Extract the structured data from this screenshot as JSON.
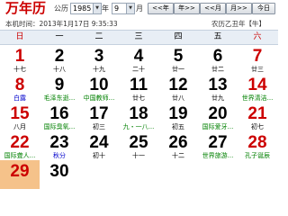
{
  "header": {
    "title": "万年历",
    "calendar_type_label": "公历",
    "year": "1985",
    "year_unit": "年",
    "month": "9",
    "month_unit": "月",
    "nav": {
      "prev_year": "<<年",
      "next_year": "年>>",
      "prev_month": "<<月",
      "next_month": "月>>",
      "today": "今日"
    }
  },
  "subheader": {
    "local_time_label": "本机时间：",
    "local_time": "2013年1月17日 9:35:33",
    "lunar_year": "农历乙丑年【牛】"
  },
  "weekdays": [
    "日",
    "一",
    "二",
    "三",
    "四",
    "五",
    "六"
  ],
  "colors": {
    "weekend": "#cc0000",
    "festival": "#008000",
    "term": "#0000cc",
    "today_bg": "#f5c28a"
  },
  "weeks": [
    [
      {
        "day": "1",
        "sub": "十七",
        "style": ""
      },
      {
        "day": "2",
        "sub": "十八",
        "style": ""
      },
      {
        "day": "3",
        "sub": "十九",
        "style": ""
      },
      {
        "day": "4",
        "sub": "二十",
        "style": ""
      },
      {
        "day": "5",
        "sub": "廿一",
        "style": ""
      },
      {
        "day": "6",
        "sub": "廿二",
        "style": ""
      },
      {
        "day": "7",
        "sub": "廿三",
        "style": ""
      }
    ],
    [
      {
        "day": "8",
        "sub": "白露",
        "style": "blue"
      },
      {
        "day": "9",
        "sub": "毛泽东逝...",
        "style": "green"
      },
      {
        "day": "10",
        "sub": "中国教师...",
        "style": "green"
      },
      {
        "day": "11",
        "sub": "廿七",
        "style": ""
      },
      {
        "day": "12",
        "sub": "廿八",
        "style": ""
      },
      {
        "day": "13",
        "sub": "廿九",
        "style": ""
      },
      {
        "day": "14",
        "sub": "世界清洁...",
        "style": "green"
      }
    ],
    [
      {
        "day": "15",
        "sub": "八月",
        "style": ""
      },
      {
        "day": "16",
        "sub": "国际臭氧...",
        "style": "green"
      },
      {
        "day": "17",
        "sub": "初三",
        "style": ""
      },
      {
        "day": "18",
        "sub": "九・一八...",
        "style": "green"
      },
      {
        "day": "19",
        "sub": "初五",
        "style": ""
      },
      {
        "day": "20",
        "sub": "国际爱牙...",
        "style": "green"
      },
      {
        "day": "21",
        "sub": "初七",
        "style": ""
      }
    ],
    [
      {
        "day": "22",
        "sub": "国际聋人...",
        "style": "green"
      },
      {
        "day": "23",
        "sub": "秋分",
        "style": "blue"
      },
      {
        "day": "24",
        "sub": "初十",
        "style": ""
      },
      {
        "day": "25",
        "sub": "十一",
        "style": ""
      },
      {
        "day": "26",
        "sub": "十二",
        "style": ""
      },
      {
        "day": "27",
        "sub": "世界旅游...",
        "style": "green"
      },
      {
        "day": "28",
        "sub": "孔子诞辰",
        "style": "green"
      }
    ],
    [
      {
        "day": "29",
        "sub": "",
        "style": "today"
      },
      {
        "day": "30",
        "sub": "",
        "style": ""
      }
    ]
  ]
}
